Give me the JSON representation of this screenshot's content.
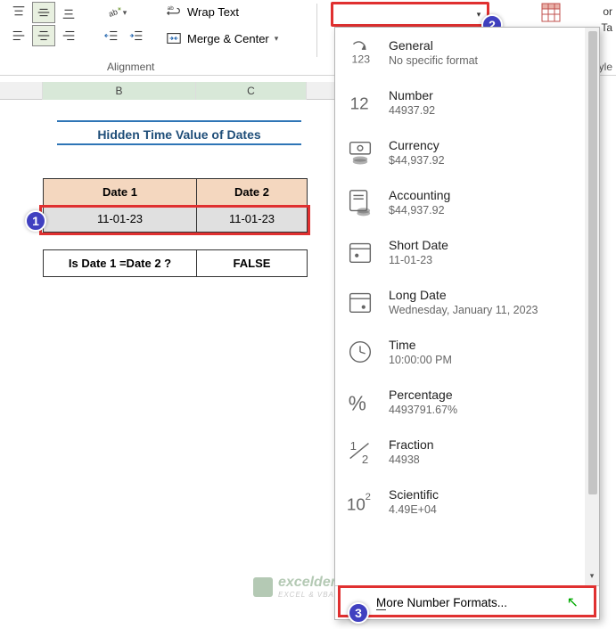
{
  "ribbon": {
    "wrap_text_label": "Wrap Text",
    "merge_center_label": "Merge & Center",
    "group_label": "Alignment",
    "number_format_value": "",
    "right_labels": {
      "or": "or",
      "ta": "Ta",
      "tyle": "tyle"
    }
  },
  "columns": {
    "b": "B",
    "c": "C"
  },
  "sheet": {
    "title": "Hidden Time Value of Dates",
    "header1": "Date 1",
    "header2": "Date 2",
    "date1": "11-01-23",
    "date2": "11-01-23",
    "question": "Is Date 1 =Date 2 ?",
    "result": "FALSE"
  },
  "dropdown": {
    "items": [
      {
        "title": "General",
        "sub": "No specific format",
        "icon": "general"
      },
      {
        "title": "Number",
        "sub": "44937.92",
        "icon": "number"
      },
      {
        "title": "Currency",
        "sub": "$44,937.92",
        "icon": "currency"
      },
      {
        "title": "Accounting",
        "sub": " $44,937.92",
        "icon": "accounting"
      },
      {
        "title": "Short Date",
        "sub": "11-01-23",
        "icon": "shortdate"
      },
      {
        "title": "Long Date",
        "sub": "Wednesday, January 11, 2023",
        "icon": "longdate"
      },
      {
        "title": "Time",
        "sub": "10:00:00 PM",
        "icon": "time"
      },
      {
        "title": "Percentage",
        "sub": "4493791.67%",
        "icon": "percentage"
      },
      {
        "title": "Fraction",
        "sub": "44938",
        "icon": "fraction"
      },
      {
        "title": "Scientific",
        "sub": "4.49E+04",
        "icon": "scientific"
      }
    ],
    "footer_prefix": "M",
    "footer_rest": "ore Number Formats..."
  },
  "callouts": {
    "c1": "1",
    "c2": "2",
    "c3": "3"
  },
  "watermark": {
    "text": "exceldemy",
    "sub": "EXCEL & VBA EXAMPLES"
  }
}
